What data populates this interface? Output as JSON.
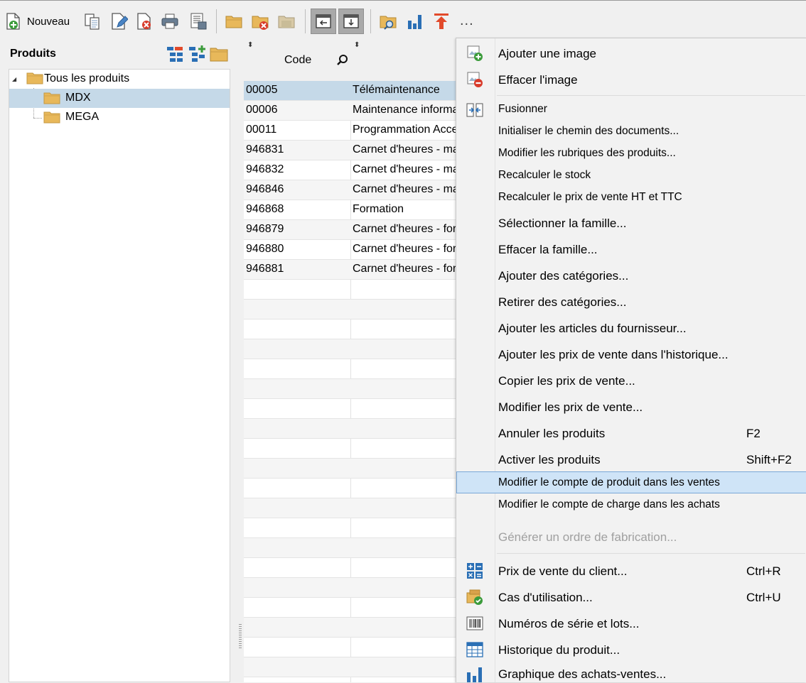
{
  "toolbar": {
    "new_label": "Nouveau",
    "icons": [
      "new-document-icon",
      "copy-document-icon",
      "edit-document-icon",
      "delete-document-icon",
      "print-icon",
      "print-preview-icon",
      "folder-icon",
      "folder-delete-icon",
      "folder-disabled-icon",
      "panel-left-icon",
      "panel-bottom-icon",
      "folder-search-icon",
      "bar-chart-icon",
      "arrow-up-icon",
      "more-icon"
    ],
    "more_label": "..."
  },
  "left_panel": {
    "title": "Produits",
    "tree": [
      {
        "label": "Tous les produits",
        "level": 0,
        "expanded": true,
        "selected": false
      },
      {
        "label": "MDX",
        "level": 1,
        "selected": true
      },
      {
        "label": "MEGA",
        "level": 1,
        "selected": false
      }
    ]
  },
  "grid": {
    "columns": [
      "Code",
      ""
    ],
    "rows": [
      {
        "code": "00005",
        "description": "Télémaintenance",
        "selected": true
      },
      {
        "code": "00006",
        "description": "Maintenance informa"
      },
      {
        "code": "00011",
        "description": "Programmation Acce"
      },
      {
        "code": "946831",
        "description": "Carnet d'heures - ma"
      },
      {
        "code": "946832",
        "description": "Carnet d'heures - ma"
      },
      {
        "code": "946846",
        "description": "Carnet d'heures - ma"
      },
      {
        "code": "946868",
        "description": "Formation"
      },
      {
        "code": "946879",
        "description": "Carnet d'heures - for"
      },
      {
        "code": "946880",
        "description": "Carnet d'heures - for"
      },
      {
        "code": "946881",
        "description": "Carnet d'heures - for"
      }
    ]
  },
  "context_menu": {
    "items": [
      {
        "label": "Ajouter une image",
        "icon": "image-add-icon"
      },
      {
        "label": "Effacer l'image",
        "icon": "image-remove-icon"
      },
      {
        "label": "Fusionner",
        "icon": "merge-icon"
      },
      {
        "label": "Initialiser le chemin des documents..."
      },
      {
        "label": "Modifier les rubriques des produits..."
      },
      {
        "label": "Recalculer le stock"
      },
      {
        "label": "Recalculer le prix de vente HT et TTC"
      },
      {
        "label": "Sélectionner la famille..."
      },
      {
        "label": "Effacer la famille..."
      },
      {
        "label": "Ajouter des catégories..."
      },
      {
        "label": "Retirer des catégories..."
      },
      {
        "label": "Ajouter les articles du fournisseur..."
      },
      {
        "label": "Ajouter les prix de vente dans l'historique..."
      },
      {
        "label": "Copier les prix de vente..."
      },
      {
        "label": "Modifier les prix de vente..."
      },
      {
        "label": "Annuler les produits",
        "shortcut": "F2"
      },
      {
        "label": "Activer les produits",
        "shortcut": "Shift+F2"
      },
      {
        "label": "Modifier le compte de produit dans les ventes",
        "highlighted": true
      },
      {
        "label": "Modifier le compte de charge dans les achats"
      },
      {
        "label": "Générer un ordre de fabrication...",
        "disabled": true
      },
      {
        "label": "Prix de vente du client...",
        "shortcut": "Ctrl+R",
        "icon": "calculator-icon"
      },
      {
        "label": "Cas d'utilisation...",
        "shortcut": "Ctrl+U",
        "icon": "usage-cases-icon"
      },
      {
        "label": "Numéros de série et lots...",
        "icon": "barcode-icon"
      },
      {
        "label": "Historique du produit...",
        "icon": "table-icon"
      },
      {
        "label": "Graphique des achats-ventes...",
        "icon": "bar-chart-icon"
      }
    ]
  },
  "colors": {
    "selection": "#c5d9e8",
    "menu_highlight": "#cfe4f7",
    "menu_highlight_border": "#7aa8d8",
    "folder": "#e8b85a",
    "chart_blue": "#2a6fb5",
    "arrow_red": "#e24a2b"
  }
}
